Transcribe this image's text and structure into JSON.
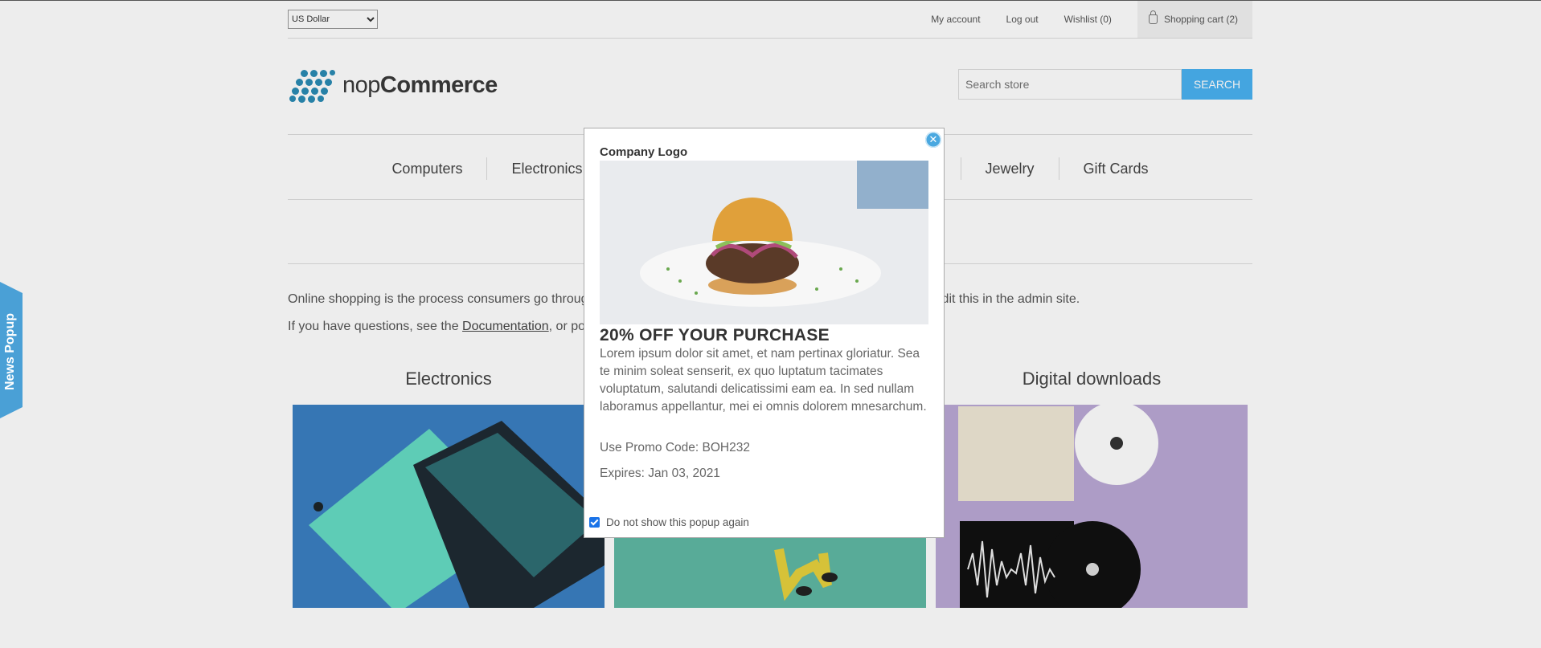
{
  "header": {
    "currency": "US Dollar",
    "links": {
      "my_account": "My account",
      "logout": "Log out",
      "wishlist": "Wishlist (0)",
      "cart": "Shopping cart (2)"
    }
  },
  "logo": {
    "prefix": "nop",
    "suffix": "Commerce"
  },
  "search": {
    "placeholder": "Search store",
    "button": "SEARCH"
  },
  "nav": {
    "items": [
      "Computers",
      "Electronics",
      "Jewelry",
      "Gift Cards"
    ]
  },
  "topic": {
    "line1_start": "Online shopping is the process consumers go throug",
    "line1_end": "dit this in the admin site.",
    "line2_start": "If you have questions, see the ",
    "line2_link": "Documentation",
    "line2_end": ", or po"
  },
  "categories": [
    "Electronics",
    "Digital downloads"
  ],
  "side_tab": "News Popup",
  "popup": {
    "company": "Company Logo",
    "headline": "20% OFF YOUR PURCHASE",
    "body": "Lorem ipsum dolor sit amet, et nam pertinax gloriatur. Sea te minim soleat senserit, ex quo luptatum tacimates voluptatum, salutandi delicatissimi eam ea. In sed nullam laboramus appellantur, mei ei omnis dolorem mnesarchum.",
    "promo": "Use Promo Code: BOH232",
    "expires": "Expires: Jan 03, 2021",
    "checkbox_label": "Do not show this popup again",
    "checkbox_checked": true
  },
  "colors": {
    "accent": "#4ab2f1",
    "side_tab": "#4aa0d6",
    "close": "#4aa8e0"
  }
}
